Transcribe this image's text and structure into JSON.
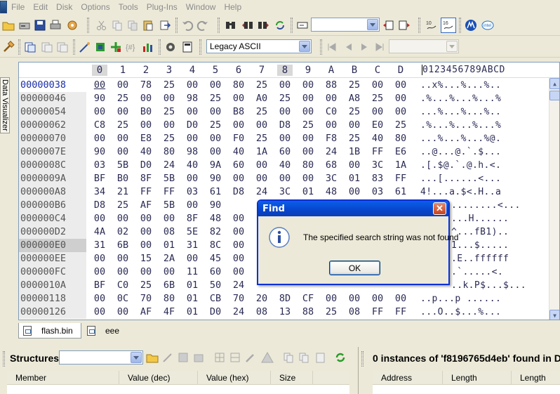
{
  "menu": [
    "File",
    "Edit",
    "Disk",
    "Options",
    "Tools",
    "Plug-Ins",
    "Window",
    "Help"
  ],
  "toolbar": {
    "search_combo_value": "",
    "charset_value": "Legacy ASCII",
    "nav_combo_value": ""
  },
  "side_tab": {
    "label": "Data Visualizer"
  },
  "hex": {
    "column_headers": [
      "0",
      "1",
      "2",
      "3",
      "4",
      "5",
      "6",
      "7",
      "8",
      "9",
      "A",
      "B",
      "C",
      "D"
    ],
    "ascii_header": "0123456789ABCD",
    "rows": [
      {
        "addr": "00000038",
        "bytes": [
          "00",
          "00",
          "78",
          "25",
          "00",
          "00",
          "80",
          "25",
          "00",
          "00",
          "88",
          "25",
          "00",
          "00"
        ],
        "ascii": "..x%...%...%.."
      },
      {
        "addr": "00000046",
        "bytes": [
          "90",
          "25",
          "00",
          "00",
          "98",
          "25",
          "00",
          "A0",
          "25",
          "00",
          "00",
          "A8",
          "25",
          "00"
        ],
        "ascii": ".%...%...%...%"
      },
      {
        "addr": "00000054",
        "bytes": [
          "00",
          "00",
          "B0",
          "25",
          "00",
          "00",
          "B8",
          "25",
          "00",
          "00",
          "C0",
          "25",
          "00",
          "00"
        ],
        "ascii": "...%...%...%.."
      },
      {
        "addr": "00000062",
        "bytes": [
          "C8",
          "25",
          "00",
          "00",
          "D0",
          "25",
          "00",
          "00",
          "D8",
          "25",
          "00",
          "00",
          "E0",
          "25"
        ],
        "ascii": ".%...%...%...%"
      },
      {
        "addr": "00000070",
        "bytes": [
          "00",
          "00",
          "E8",
          "25",
          "00",
          "00",
          "F0",
          "25",
          "00",
          "00",
          "F8",
          "25",
          "40",
          "80"
        ],
        "ascii": "...%...%...%@."
      },
      {
        "addr": "0000007E",
        "bytes": [
          "90",
          "00",
          "40",
          "80",
          "98",
          "00",
          "40",
          "1A",
          "60",
          "00",
          "24",
          "1B",
          "FF",
          "E6"
        ],
        "ascii": "..@...@.`.$..."
      },
      {
        "addr": "0000008C",
        "bytes": [
          "03",
          "5B",
          "D0",
          "24",
          "40",
          "9A",
          "60",
          "00",
          "40",
          "80",
          "68",
          "00",
          "3C",
          "1A"
        ],
        "ascii": ".[.$@.`.@.h.<."
      },
      {
        "addr": "0000009A",
        "bytes": [
          "BF",
          "B0",
          "8F",
          "5B",
          "00",
          "90",
          "00",
          "00",
          "00",
          "00",
          "3C",
          "01",
          "83",
          "FF"
        ],
        "ascii": "...[......<..."
      },
      {
        "addr": "000000A8",
        "bytes": [
          "34",
          "21",
          "FF",
          "FF",
          "03",
          "61",
          "D8",
          "24",
          "3C",
          "01",
          "48",
          "00",
          "03",
          "61"
        ],
        "ascii": "4!...a.$<.H..a"
      },
      {
        "addr": "000000B6",
        "bytes": [
          "D8",
          "25",
          "AF",
          "5B",
          "00",
          "90",
          "",
          "",
          "",
          "",
          "",
          "",
          "",
          ""
        ],
        "ascii": "........<..."
      },
      {
        "addr": "000000C4",
        "bytes": [
          "00",
          "00",
          "00",
          "00",
          "8F",
          "48",
          "00",
          "",
          "",
          "",
          "",
          "",
          "",
          ""
        ],
        "ascii": "...H......"
      },
      {
        "addr": "000000D2",
        "bytes": [
          "4A",
          "02",
          "00",
          "08",
          "5E",
          "82",
          "00",
          "",
          "",
          "",
          "",
          "",
          "",
          ""
        ],
        "ascii": "^...fB1).."
      },
      {
        "addr": "000000E0",
        "bytes": [
          "31",
          "6B",
          "00",
          "01",
          "31",
          "8C",
          "00",
          "",
          "",
          "",
          "",
          "",
          "",
          ""
        ],
        "ascii": "1...$....."
      },
      {
        "addr": "000000EE",
        "bytes": [
          "00",
          "00",
          "15",
          "2A",
          "00",
          "45",
          "00",
          "",
          "",
          "",
          "",
          "",
          "",
          ""
        ],
        "ascii": ".E..ffffff"
      },
      {
        "addr": "000000FC",
        "bytes": [
          "00",
          "00",
          "00",
          "00",
          "11",
          "60",
          "00",
          "",
          "",
          "",
          "",
          "",
          "",
          ""
        ],
        "ascii": ".`.....<."
      },
      {
        "addr": "0000010A",
        "bytes": [
          "BF",
          "C0",
          "25",
          "6B",
          "01",
          "50",
          "24",
          "",
          "",
          "",
          "",
          "",
          "",
          ""
        ],
        "ascii": "..k.P$...$..."
      },
      {
        "addr": "00000118",
        "bytes": [
          "00",
          "0C",
          "70",
          "80",
          "01",
          "CB",
          "70",
          "20",
          "8D",
          "CF",
          "00",
          "00",
          "00",
          "00"
        ],
        "ascii": "..p...p ......"
      },
      {
        "addr": "00000126",
        "bytes": [
          "00",
          "00",
          "AF",
          "4F",
          "01",
          "D0",
          "24",
          "08",
          "13",
          "88",
          "25",
          "08",
          "FF",
          "FF"
        ],
        "ascii": "...O..$...%..."
      }
    ]
  },
  "file_tabs": [
    "flash.bin",
    "eee"
  ],
  "structures_panel": {
    "title": "Structures",
    "combo_value": "",
    "columns": [
      "Member",
      "Value (dec)",
      "Value (hex)",
      "Size"
    ]
  },
  "results_panel": {
    "title": "0 instances of 'f8196765d4eb' found in D:",
    "columns": [
      "Address",
      "Length",
      "Length"
    ]
  },
  "dialog": {
    "title": "Find",
    "message": "The specified search string was not found",
    "ok_label": "OK",
    "icon": "info-icon"
  }
}
